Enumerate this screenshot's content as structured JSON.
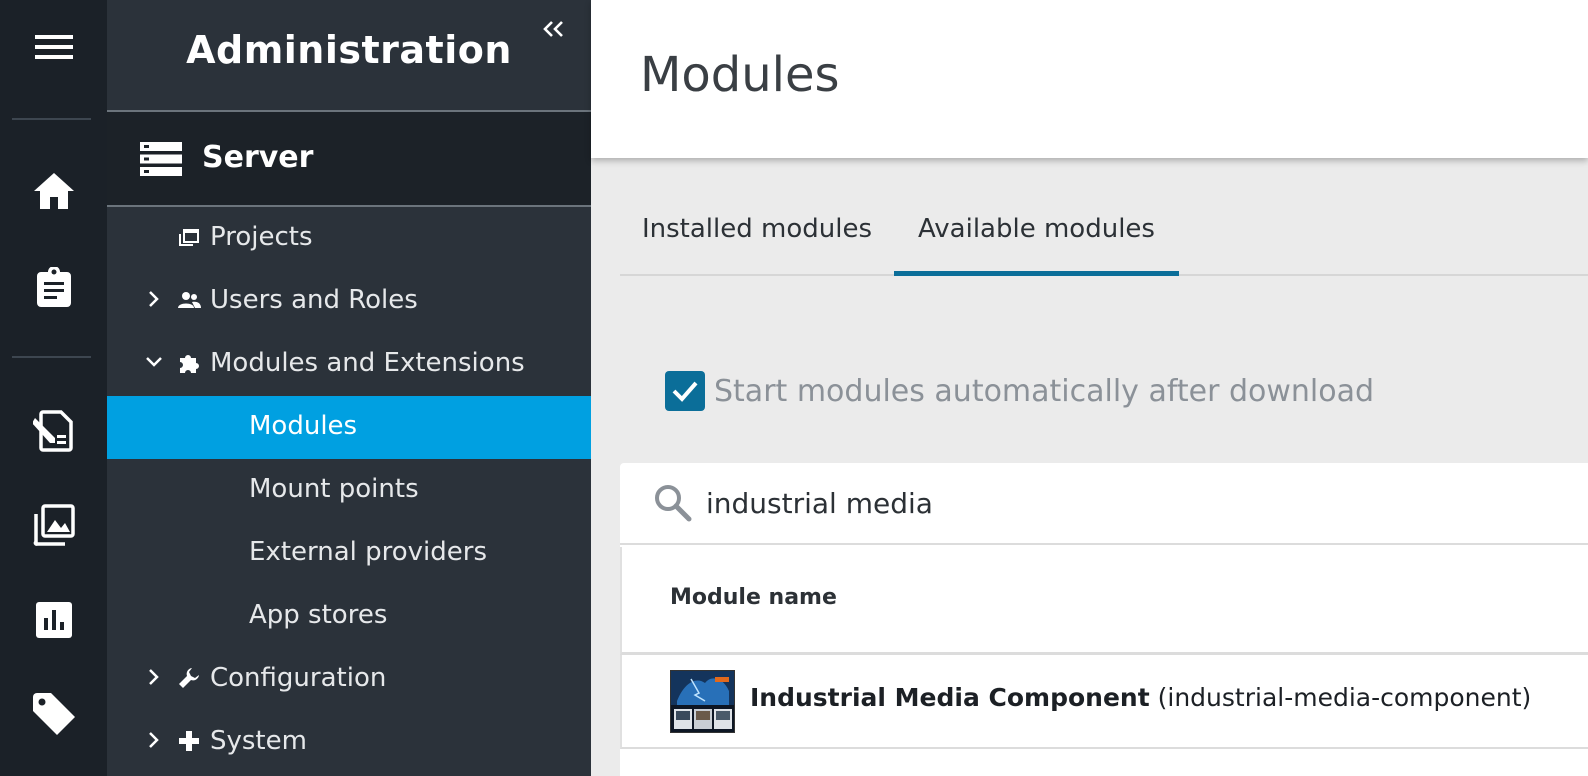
{
  "rail": {
    "items": [
      {
        "name": "menu-icon"
      },
      {
        "name": "home-icon"
      },
      {
        "name": "clipboard-icon"
      },
      {
        "name": "edit-document-icon"
      },
      {
        "name": "images-icon"
      },
      {
        "name": "bar-chart-icon"
      },
      {
        "name": "tag-icon"
      }
    ]
  },
  "sidebar": {
    "title": "Administration",
    "collapse_icon": "double-chevron-left-icon",
    "section": "Server",
    "items": [
      {
        "label": "Projects",
        "icon": "projects-icon"
      },
      {
        "label": "Users and Roles",
        "icon": "users-icon",
        "expanded": false
      },
      {
        "label": "Modules and Extensions",
        "icon": "puzzle-icon",
        "expanded": true
      },
      {
        "label": "Modules",
        "active": true
      },
      {
        "label": "Mount points"
      },
      {
        "label": "External providers"
      },
      {
        "label": "App stores"
      },
      {
        "label": "Configuration",
        "icon": "wrench-icon",
        "expanded": false
      },
      {
        "label": "System",
        "icon": "plus-icon",
        "expanded": false
      }
    ]
  },
  "main": {
    "title": "Modules",
    "tabs": [
      {
        "label": "Installed modules",
        "active": false
      },
      {
        "label": "Available modules",
        "active": true
      }
    ],
    "auto_start": {
      "label": "Start modules automatically after download",
      "checked": true
    },
    "search": {
      "value": "industrial media"
    },
    "table": {
      "column_header": "Module name",
      "rows": [
        {
          "name": "Industrial Media Component",
          "id": "(industrial-media-component)"
        }
      ]
    }
  },
  "colors": {
    "rail_bg": "#1b2128",
    "sidebar_bg": "#2b323a",
    "active_item": "#00a0e1",
    "tab_underline": "#0b6e99",
    "checkbox": "#0b6e99"
  }
}
